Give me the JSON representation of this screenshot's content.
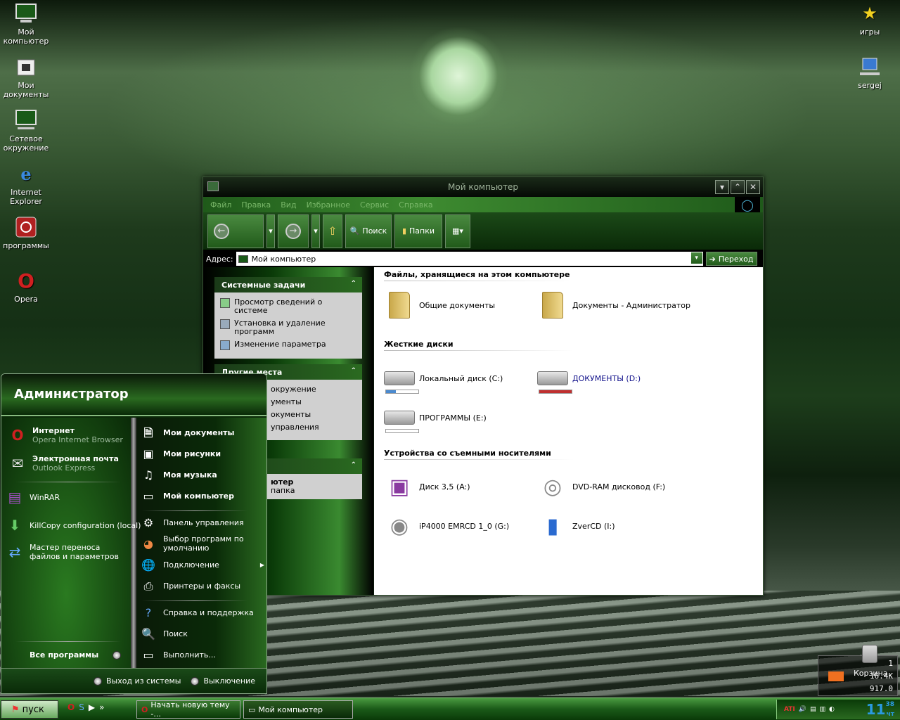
{
  "desktop": {
    "icons": [
      {
        "label": "Мой компьютер",
        "icon": "computer-icon"
      },
      {
        "label": "Мои документы",
        "icon": "documents-icon"
      },
      {
        "label": "Сетевое окружение",
        "icon": "network-icon"
      },
      {
        "label": "Internet Explorer",
        "icon": "ie-icon"
      },
      {
        "label": "программы",
        "icon": "power-icon"
      },
      {
        "label": "Opera",
        "icon": "opera-icon"
      },
      {
        "label": "игры",
        "icon": "star-icon"
      },
      {
        "label": "sergej",
        "icon": "network-computer-icon"
      }
    ],
    "recycle_label": "Корзина",
    "meter": {
      "a": "1",
      "b": "16.4K",
      "c": "917.0"
    }
  },
  "window": {
    "title": "Мой компьютер",
    "menu": [
      "Файл",
      "Правка",
      "Вид",
      "Избранное",
      "Сервис",
      "Справка"
    ],
    "toolbar": {
      "search": "Поиск",
      "folders": "Папки"
    },
    "address_label": "Адрес:",
    "address_value": "Мой компьютер",
    "go_label": "Переход",
    "tasks": {
      "system_title": "Системные задачи",
      "system_items": [
        "Просмотр сведений о системе",
        "Установка и удаление программ",
        "Изменение параметра"
      ],
      "other_title": "Другие места",
      "other_items": [
        "окружение",
        "ументы",
        "окументы",
        "управления"
      ],
      "details_title": "",
      "details_items": [
        "ютер",
        "папка"
      ]
    },
    "sections": {
      "files": "Файлы, хранящиеся на этом компьютере",
      "hdd": "Жесткие диски",
      "removable": "Устройства со съемными носителями"
    },
    "files": [
      "Общие документы",
      "Документы - Администратор"
    ],
    "drives": [
      {
        "label": "Локальный диск (C:)",
        "fill": 0.3
      },
      {
        "label": "ДОКУМЕНТЫ (D:)",
        "fill": 1.0
      },
      {
        "label": "ПРОГРАММЫ (E:)",
        "fill": 0.0
      }
    ],
    "removable": [
      "Диск 3,5 (A:)",
      "DVD-RAM дисковод (F:)",
      "iP4000 EMRCD 1_0 (G:)",
      "ZverCD (I:)"
    ]
  },
  "start_menu": {
    "user": "Администратор",
    "left": [
      {
        "title": "Интернет",
        "sub": "Opera Internet Browser"
      },
      {
        "title": "Электронная почта",
        "sub": "Outlook Express"
      },
      {
        "title": "WinRAR",
        "sub": ""
      },
      {
        "title": "KillCopy configuration (local)",
        "sub": ""
      },
      {
        "title": "Мастер переноса файлов и параметров",
        "sub": ""
      }
    ],
    "all_programs": "Все программы",
    "right": [
      "Мои документы",
      "Мои рисунки",
      "Моя музыка",
      "Мой компьютер",
      "Панель управления",
      "Выбор программ по умолчанию",
      "Подключение",
      "Принтеры и факсы",
      "Справка и поддержка",
      "Поиск",
      "Выполнить..."
    ],
    "logoff": "Выход из системы",
    "shutdown": "Выключение"
  },
  "taskbar": {
    "start_label": "пуск",
    "tasks": [
      "Начать новую тему -...",
      "Мой компьютер"
    ],
    "clock_hour": "11",
    "clock_min": "38",
    "clock_day": "чт"
  },
  "colors": {
    "accent": "#2a6a20",
    "window_bg": "#0a1a0a",
    "drive_full": "#c03030",
    "drive_used": "#4a8ad0"
  }
}
